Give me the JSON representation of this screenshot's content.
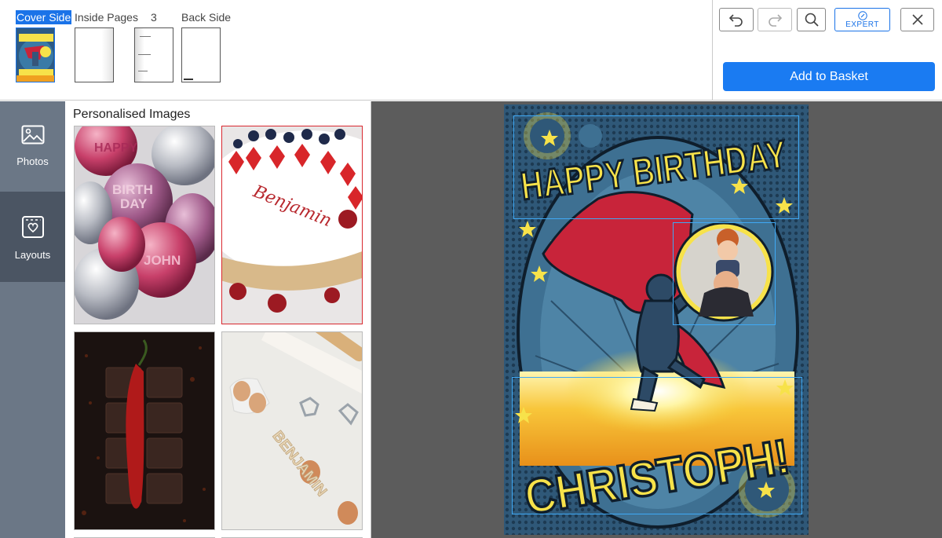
{
  "pages": {
    "cover_label": "Cover Side",
    "inside_label": "Inside Pages",
    "inside_count": "3",
    "back_label": "Back Side"
  },
  "toolbar": {
    "undo_icon": "undo-icon",
    "redo_icon": "redo-icon",
    "zoom_icon": "magnifier-icon",
    "expert_label": "EXPERT",
    "close_icon": "close-icon",
    "basket_label": "Add to Basket"
  },
  "rail": {
    "items": [
      {
        "label": "Photos",
        "icon": "image-icon"
      },
      {
        "label": "Layouts",
        "icon": "layout-icon"
      }
    ]
  },
  "panel": {
    "title": "Personalised Images",
    "images": [
      {
        "subject": "balloons",
        "texts": [
          "HAPPY",
          "BIRTH",
          "DAY",
          "JOHN"
        ]
      },
      {
        "subject": "cake",
        "texts": [
          "Benjamin"
        ]
      },
      {
        "subject": "chocolate-chili",
        "texts": []
      },
      {
        "subject": "baking-letters",
        "texts": [
          "BENJAMIN"
        ]
      }
    ]
  },
  "card": {
    "headline": "HAPPY BIRTHDAY",
    "name": "CHRISTOPH!"
  },
  "colors": {
    "accent": "#1a7bf2",
    "selection": "#3fa9f5",
    "rail_bg": "#6b7786",
    "rail_active": "#4b5563",
    "canvas_bg": "#5c5c5c",
    "comic_yellow": "#f7e24a",
    "comic_red": "#c8243a",
    "comic_blue": "#3a6a8a"
  }
}
